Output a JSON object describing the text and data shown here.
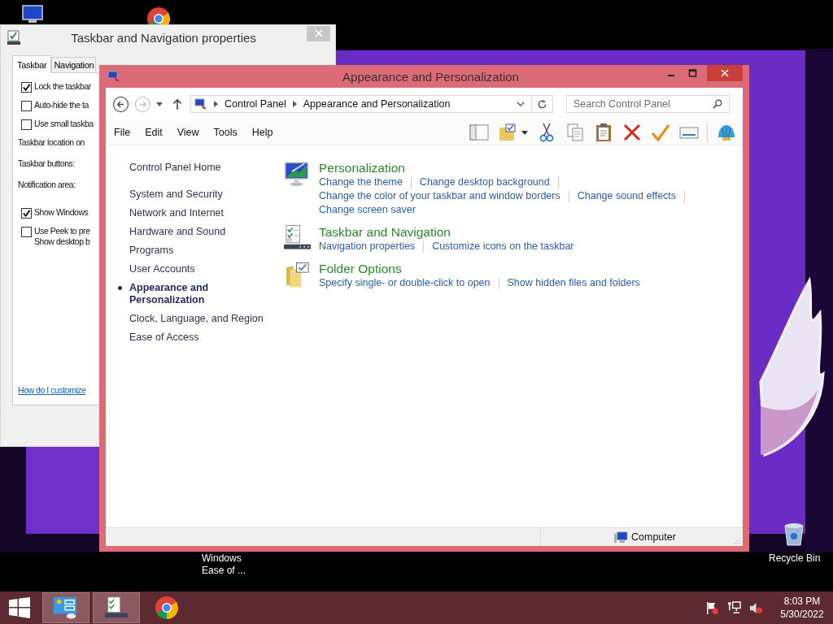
{
  "desktop": {
    "shortcuts": [
      {
        "kind": "ease-of-access",
        "label": "Windows Ease of ..."
      },
      {
        "kind": "recycle-bin",
        "label": "Recycle Bin"
      }
    ]
  },
  "properties_window": {
    "title": "Taskbar and Navigation properties",
    "tabs": [
      {
        "label": "Taskbar",
        "selected": true
      },
      {
        "label": "Navigation",
        "selected": false
      }
    ],
    "options": [
      {
        "kind": "checkbox",
        "lines": [
          "Lock the taskbar"
        ],
        "checked": true
      },
      {
        "kind": "checkbox",
        "lines": [
          "Auto-hide the ta"
        ],
        "checked": false
      },
      {
        "kind": "checkbox",
        "lines": [
          "Use small taskba"
        ],
        "checked": false
      },
      {
        "kind": "setting",
        "lines": [
          "Taskbar location on"
        ]
      },
      {
        "kind": "setting",
        "lines": [
          "Taskbar buttons:"
        ]
      },
      {
        "kind": "setting",
        "lines": [
          "Notification area:"
        ]
      },
      {
        "kind": "checkbox",
        "lines": [
          "Show Windows"
        ],
        "checked": true
      },
      {
        "kind": "checkbox",
        "lines": [
          "Use Peek to pre",
          "Show desktop b"
        ],
        "checked": false
      }
    ],
    "help_link": "How do I customize"
  },
  "main_window": {
    "title": "Appearance and Personalization",
    "back_disabled": false,
    "forward_disabled": true,
    "address": [
      "Control Panel",
      "Appearance and Personalization"
    ],
    "search_placeholder": "Search Control Panel",
    "menu": [
      "File",
      "Edit",
      "View",
      "Tools",
      "Help"
    ],
    "nav": [
      {
        "kind": "home",
        "label": "Control Panel Home",
        "selected": false
      },
      {
        "kind": "category",
        "label": "System and Security",
        "selected": false
      },
      {
        "kind": "category",
        "label": "Network and Internet",
        "selected": false
      },
      {
        "kind": "category",
        "label": "Hardware and Sound",
        "selected": false
      },
      {
        "kind": "category",
        "label": "Programs",
        "selected": false
      },
      {
        "kind": "category",
        "label": "User Accounts",
        "selected": false
      },
      {
        "kind": "category",
        "label": "Appearance and Personalization",
        "selected": true
      },
      {
        "kind": "category",
        "label": "Clock, Language, and Region",
        "selected": false
      },
      {
        "kind": "category",
        "label": "Ease of Access",
        "selected": false
      }
    ],
    "categories": [
      {
        "kind": "personalization",
        "title": "Personalization",
        "links": [
          "Change the theme",
          "Change desktop background",
          "Change the color of your taskbar and window borders",
          "Change sound effects",
          "Change screen saver"
        ]
      },
      {
        "kind": "taskbar",
        "title": "Taskbar and Navigation",
        "links": [
          "Navigation properties",
          "Customize icons on the taskbar"
        ]
      },
      {
        "kind": "folder",
        "title": "Folder Options",
        "links": [
          "Specify single- or double-click to open",
          "Show hidden files and folders"
        ]
      }
    ],
    "status": "Computer"
  },
  "taskbar": {
    "buttons": [
      {
        "kind": "control-panel",
        "open": true
      },
      {
        "kind": "taskbar-settings",
        "open": true
      },
      {
        "kind": "chrome",
        "open": false
      }
    ],
    "clock": {
      "time": "8:03 PM",
      "date": "5/30/2022"
    }
  }
}
